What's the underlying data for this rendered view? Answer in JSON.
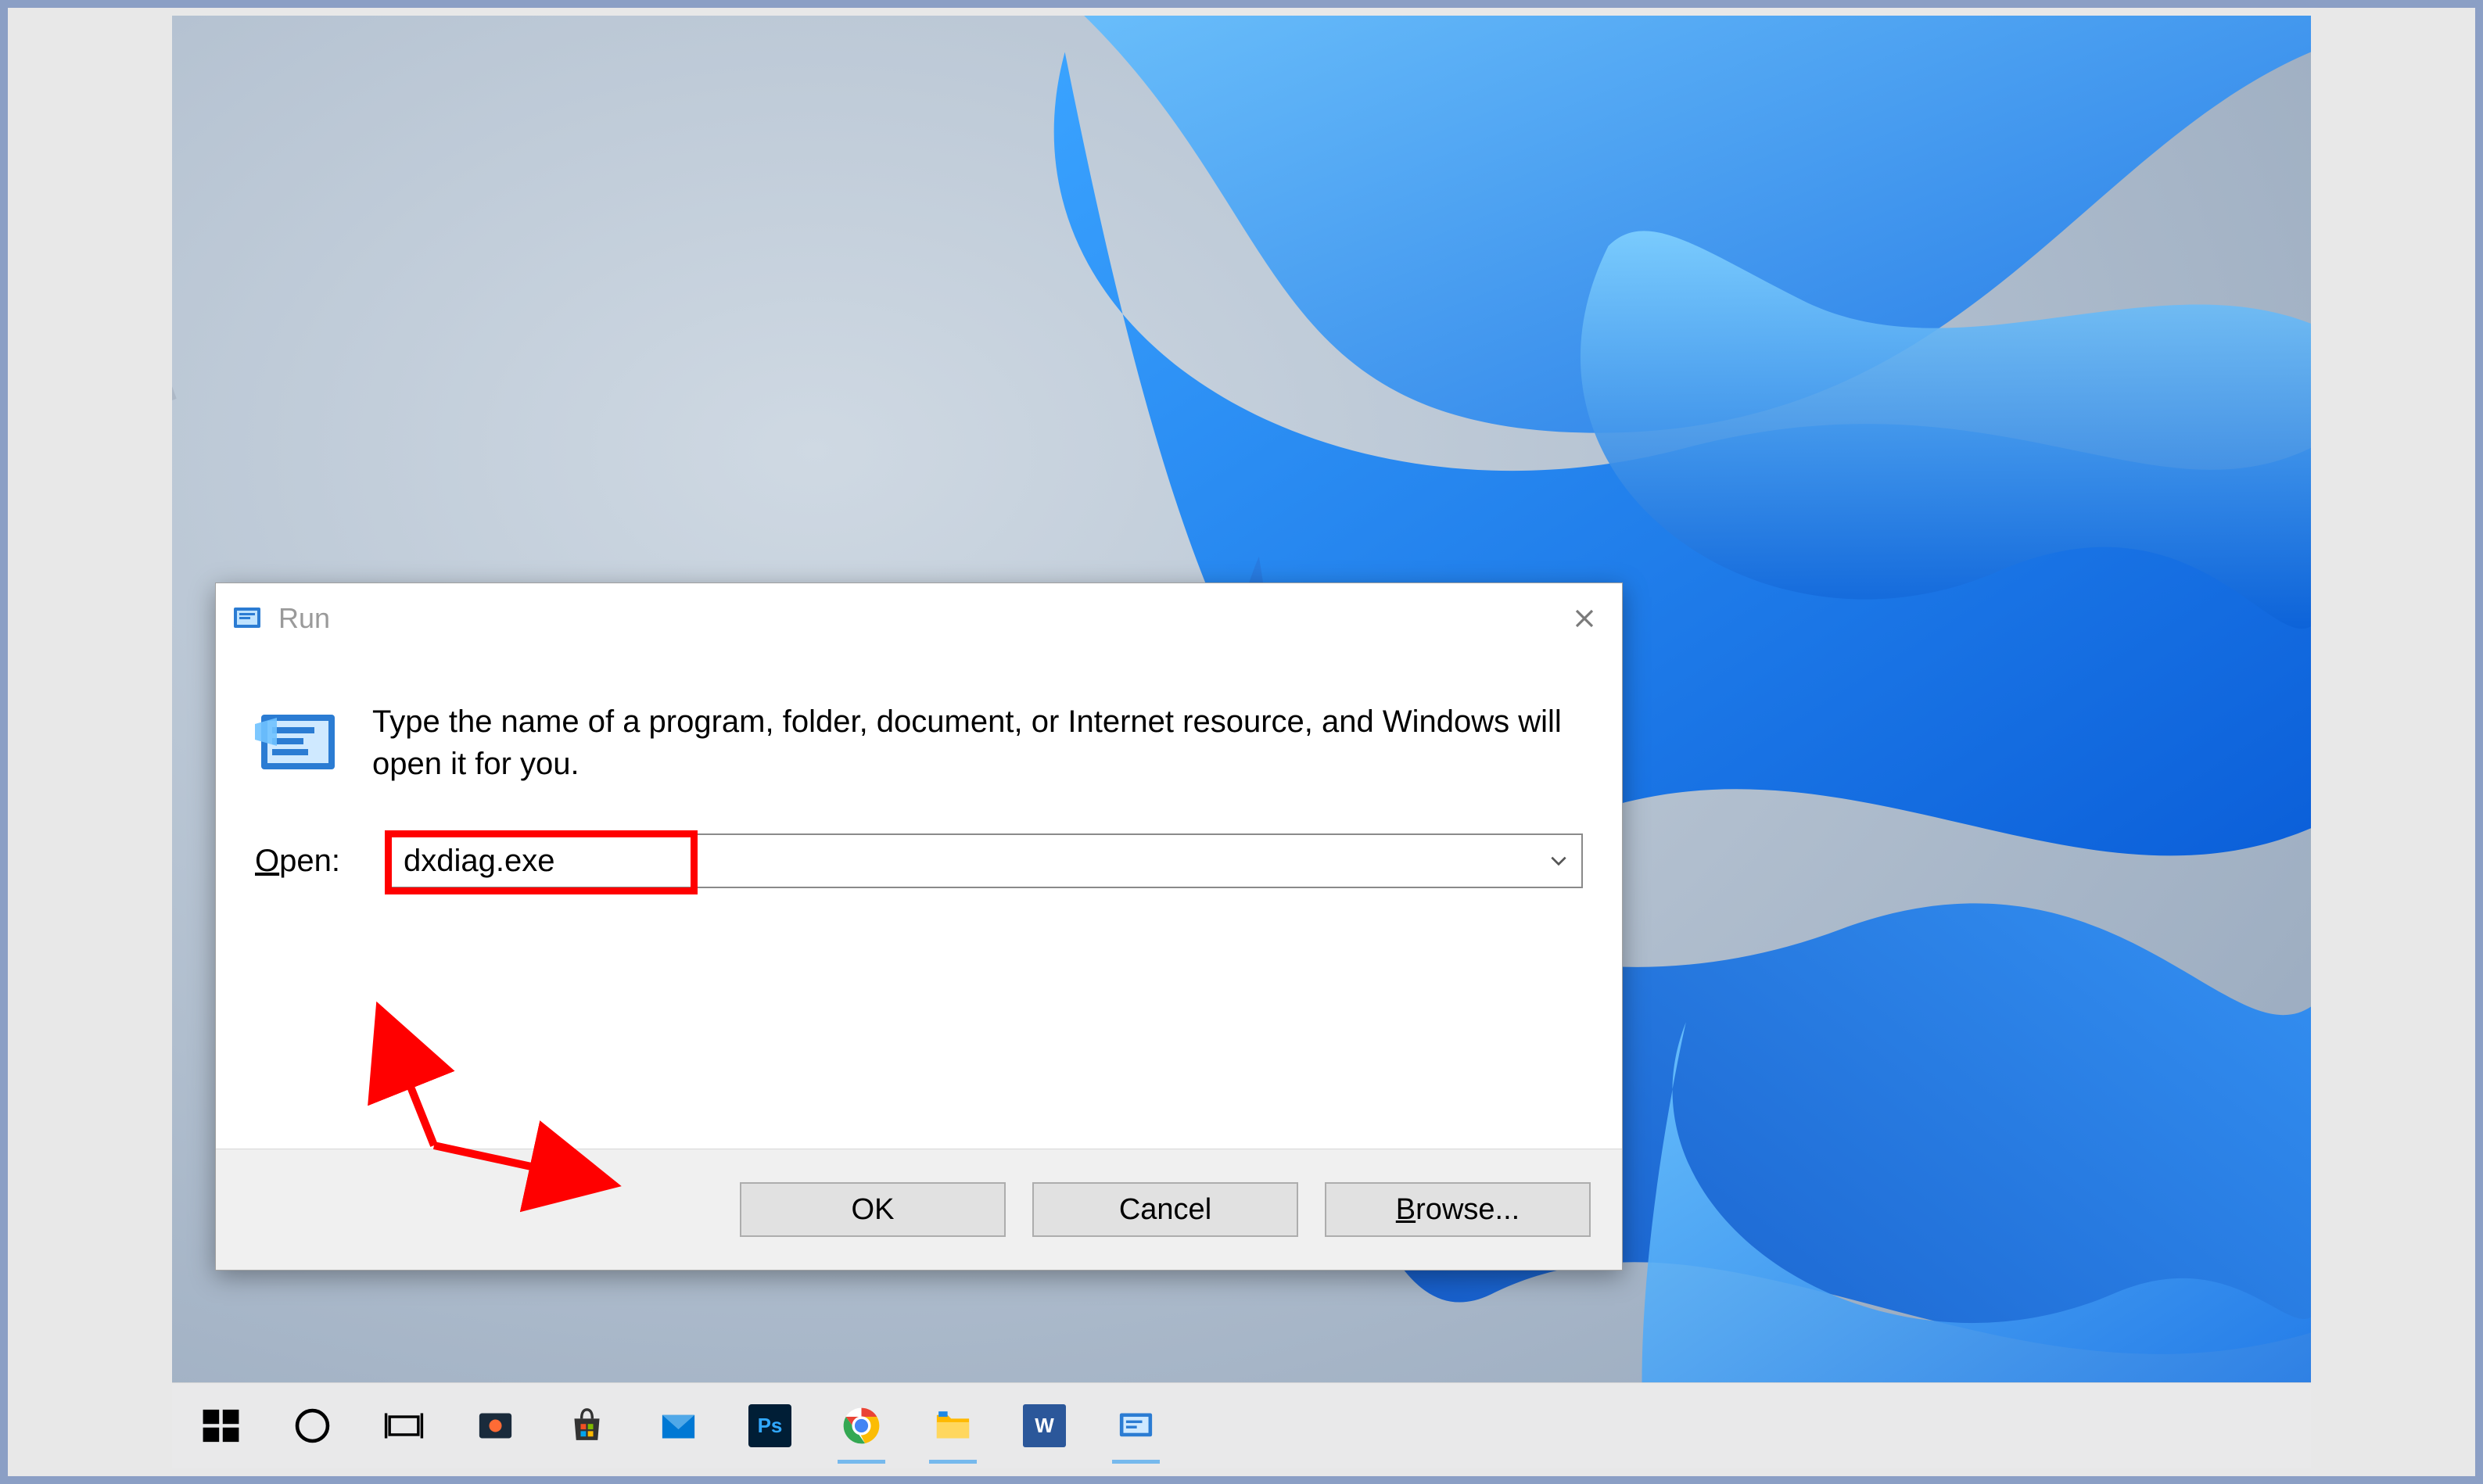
{
  "dialog": {
    "title": "Run",
    "description": "Type the name of a program, folder, document, or Internet resource, and Windows will open it for you.",
    "open_label_prefix": "O",
    "open_label_rest": "pen:",
    "input_value": "dxdiag.exe",
    "buttons": {
      "ok": "OK",
      "cancel": "Cancel",
      "browse_prefix": "B",
      "browse_rest": "rowse..."
    }
  },
  "taskbar": {
    "items": [
      {
        "name": "start",
        "icon": "windows-logo"
      },
      {
        "name": "cortana",
        "icon": "circle"
      },
      {
        "name": "taskview",
        "icon": "taskview"
      },
      {
        "name": "screenrec",
        "icon": "screenrec"
      },
      {
        "name": "store",
        "icon": "store"
      },
      {
        "name": "mail",
        "icon": "mail"
      },
      {
        "name": "photoshop",
        "icon": "ps",
        "label": "Ps"
      },
      {
        "name": "chrome",
        "icon": "chrome"
      },
      {
        "name": "explorer",
        "icon": "explorer"
      },
      {
        "name": "word",
        "icon": "word",
        "label": "W"
      },
      {
        "name": "run",
        "icon": "run"
      }
    ]
  }
}
